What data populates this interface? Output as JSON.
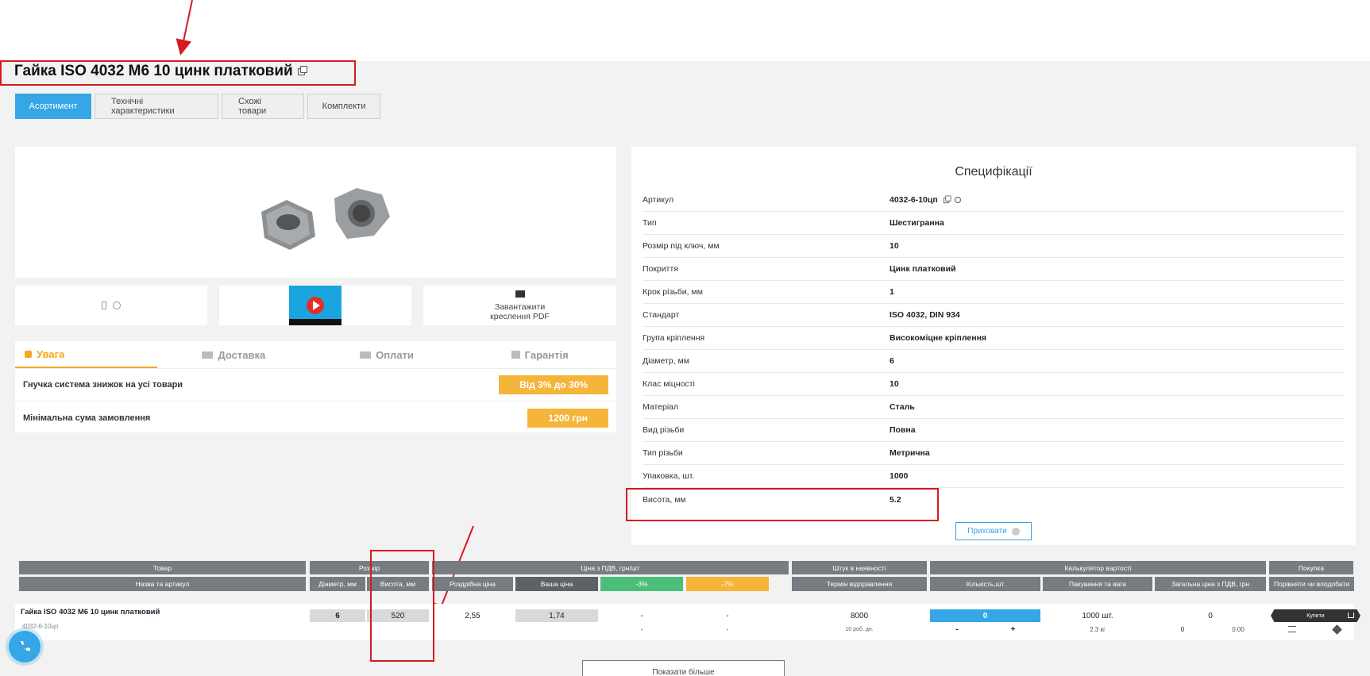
{
  "product": {
    "title": "Гайка ISO 4032 М6 10 цинк платковий"
  },
  "tabs": [
    "Асортимент",
    "Технічні характеристики",
    "Схожі товари",
    "Комплекти"
  ],
  "media": {
    "download_line1": "Завантажити",
    "download_line2": "креслення PDF"
  },
  "info": {
    "tabs": [
      "Увага",
      "Доставка",
      "Оплати",
      "Гарантія"
    ],
    "rows": [
      {
        "label": "Гнучка система знижок на усі товари",
        "badge": "Від 3% до 30%"
      },
      {
        "label": "Мінімальна сума замовлення",
        "badge": "1200 грн"
      }
    ]
  },
  "specs": {
    "title": "Специфікації",
    "rows": [
      {
        "key": "Артикул",
        "value": "4032-6-10цп"
      },
      {
        "key": "Тип",
        "value": "Шестигранна"
      },
      {
        "key": "Розмір під ключ, мм",
        "value": "10"
      },
      {
        "key": "Покриття",
        "value": "Цинк платковий"
      },
      {
        "key": "Крок різьби, мм",
        "value": "1"
      },
      {
        "key": "Стандарт",
        "value": "ISO 4032, DIN 934"
      },
      {
        "key": "Група кріплення",
        "value": "Високоміцне кріплення"
      },
      {
        "key": "Діаметр, мм",
        "value": "6"
      },
      {
        "key": "Клас міцності",
        "value": "10"
      },
      {
        "key": "Матеріал",
        "value": "Сталь"
      },
      {
        "key": "Вид різьби",
        "value": "Повна"
      },
      {
        "key": "Тип різьби",
        "value": "Метрична"
      },
      {
        "key": "Упаковка, шт.",
        "value": "1000"
      },
      {
        "key": "Висота, мм",
        "value": "5.2"
      }
    ],
    "hide_label": "Приховати"
  },
  "table": {
    "groups": {
      "product": "Товар",
      "size": "Розмір",
      "price": "Ціна з ПДВ, грн/шт",
      "stock": "Штук в наявності",
      "calc": "Калькулятор вартості",
      "buy": "Покупка"
    },
    "sub": {
      "name": "Назва та артикул",
      "diameter": "Діаметр, мм",
      "height": "Висота, мм",
      "retail": "Роздрібна ціна",
      "your": "Ваша ціна",
      "d3": "-3%",
      "d7": "-7%",
      "ship": "Термін відправлення",
      "qty": "Кількість,шт",
      "pack": "Пакування та вага",
      "total": "Загальна ціна з ПДВ, грн",
      "compare": "Порівняти чи вподобати"
    },
    "row": {
      "name": "Гайка ISO 4032 М6 10 цинк платковий",
      "sku": "4032-6-10цп",
      "diameter": "6",
      "height": "520",
      "retail": "2,55",
      "your": "1,74",
      "d3": "-",
      "d7": "-",
      "d3b": "-",
      "d7b": "-",
      "stock": "8000",
      "ship": "10 роб. дн.",
      "qty": "0",
      "minus": "-",
      "plus": "+",
      "pack": "1000 шт.",
      "weight": "2.3 кг",
      "total": "0",
      "t1": "0",
      "t2": "0.00",
      "buy": "Купити"
    }
  },
  "more_label": "Показати більше",
  "colors": {
    "accent": "#35a6e6",
    "warn": "#f5b53a",
    "annotation": "#d71921"
  }
}
